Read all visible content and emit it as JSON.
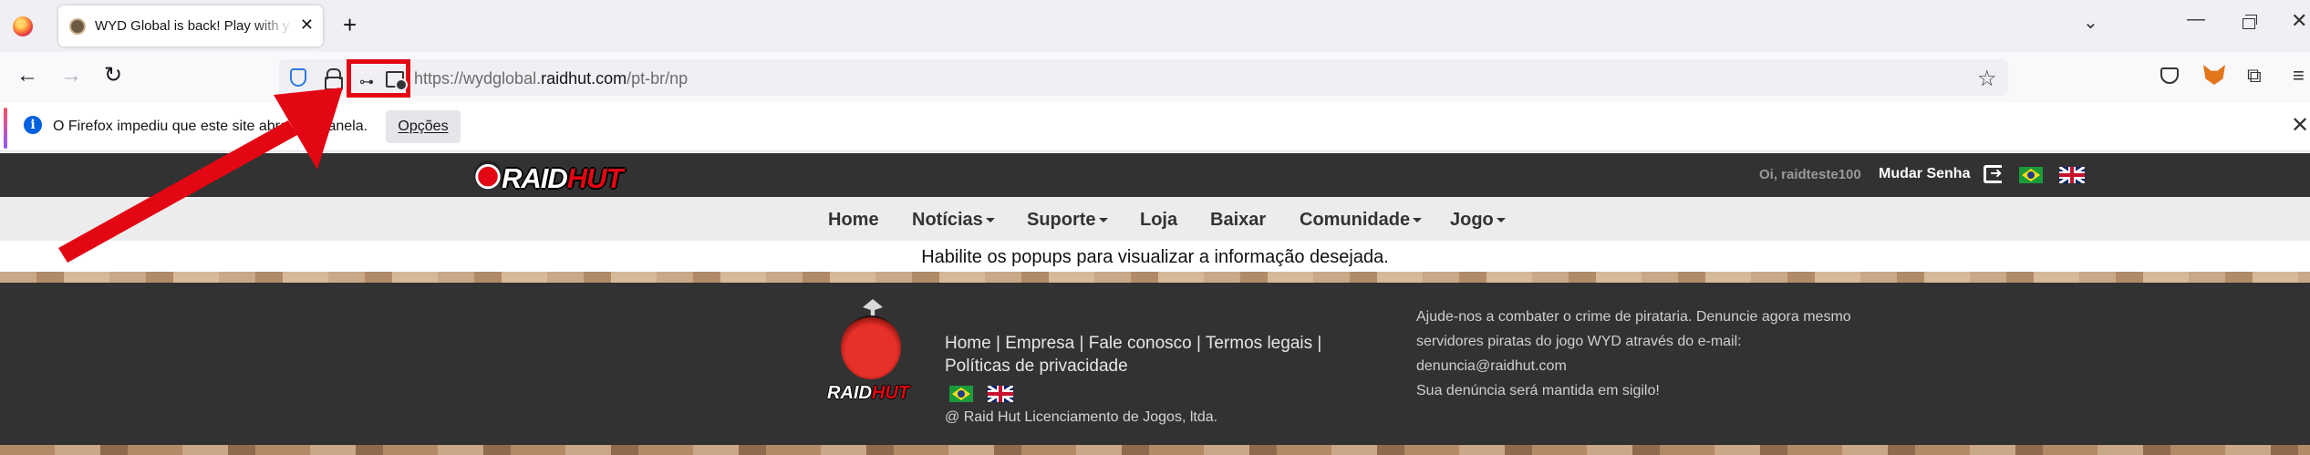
{
  "browser": {
    "tab_title": "WYD Global is back! Play with y",
    "url_prefix": "https://wydglobal.",
    "url_domain": "raidhut.com",
    "url_path": "/pt-br/np",
    "notification": "O Firefox impediu que este site abra uma janela.",
    "options_label": "Opções"
  },
  "site": {
    "logo_part1": "RAID",
    "logo_part2": "HUT",
    "greeting": "Oi, raidteste100",
    "change_password": "Mudar Senha",
    "nav": [
      {
        "label": "Home"
      },
      {
        "label": "Notícias"
      },
      {
        "label": "Suporte"
      },
      {
        "label": "Loja"
      },
      {
        "label": "Baixar"
      },
      {
        "label": "Comunidade"
      },
      {
        "label": "Jogo"
      }
    ],
    "popup_message": "Habilite os popups para visualizar a informação desejada."
  },
  "footer": {
    "links": [
      "Home",
      "Empresa",
      "Fale conosco",
      "Termos legais",
      "Políticas de privacidade"
    ],
    "separator": "|",
    "copyright": "@ Raid Hut Licenciamento de Jogos, ltda.",
    "report_line1": "Ajude-nos a combater o crime de pirataria. Denuncie agora mesmo",
    "report_line2": "servidores piratas do jogo WYD através do e-mail:",
    "report_email": "denuncia@raidhut.com",
    "report_line3": "Sua denúncia será mantida em sigilo!"
  },
  "colors": {
    "annotation": "#e30613",
    "header_bg": "#323232",
    "nav_bg": "#ececec"
  }
}
